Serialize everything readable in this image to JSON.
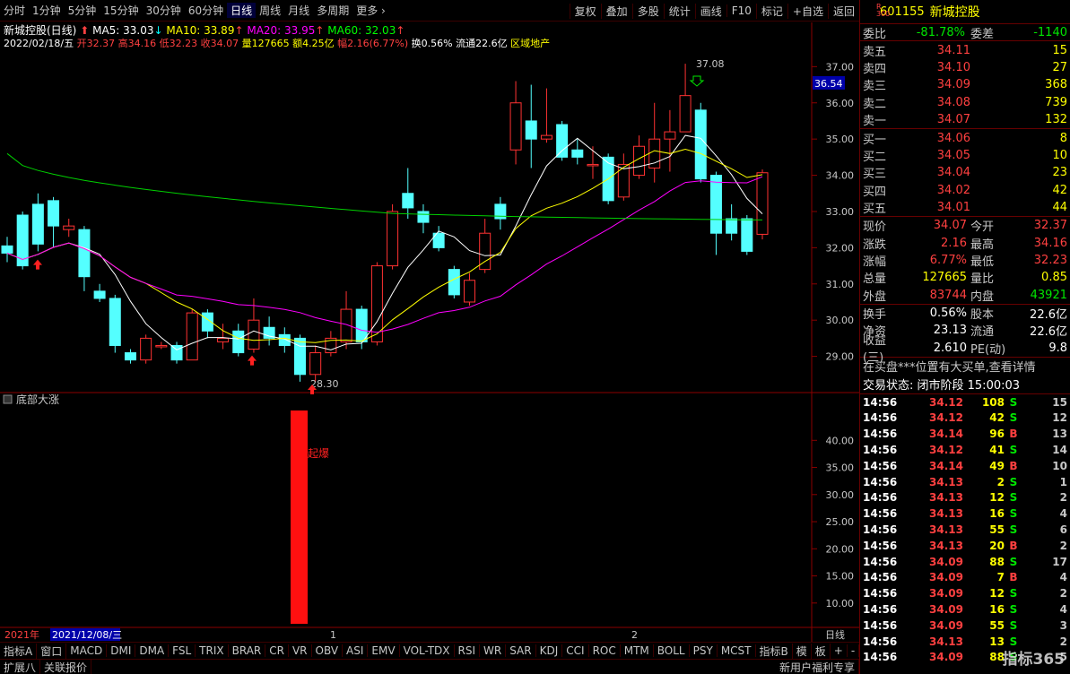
{
  "toolbar": {
    "periods": [
      "分时",
      "1分钟",
      "5分钟",
      "15分钟",
      "30分钟",
      "60分钟",
      "日线",
      "周线",
      "月线",
      "多周期",
      "更多"
    ],
    "active": "日线",
    "right": [
      "复权",
      "叠加",
      "多股",
      "统计",
      "画线",
      "F10",
      "标记",
      "+自选",
      "返回"
    ]
  },
  "info": {
    "title": "新城控股(日线)",
    "ma5": "MA5: 33.03",
    "ma10": "MA10: 33.89",
    "ma20": "MA20: 33.95",
    "ma60": "MA60: 32.03",
    "date": "2022/02/18/五",
    "open": "开32.37",
    "high": "高34.16",
    "low": "低32.23",
    "close": "收34.07",
    "vol": "量127665",
    "amt": "额4.25亿",
    "chg": "幅2.16(6.77%)",
    "turn": "换0.56%",
    "float": "流通22.6亿",
    "sector": "区域地产"
  },
  "chart_data": {
    "type": "candlestick",
    "price_axis": [
      "37.00",
      "36.00",
      "35.00",
      "34.00",
      "33.00",
      "32.00",
      "31.00",
      "30.00",
      "29.00"
    ],
    "current_price_tag": "36.54",
    "max_label": "37.08",
    "min_label": "28.30",
    "candles": [
      [
        32.05,
        31.85,
        32.3,
        31.6
      ],
      [
        32.9,
        31.5,
        33.0,
        31.4
      ],
      [
        33.2,
        32.1,
        33.5,
        31.9
      ],
      [
        33.3,
        32.6,
        33.4,
        32.0
      ],
      [
        32.5,
        32.6,
        32.8,
        32.3
      ],
      [
        32.5,
        31.2,
        32.6,
        30.8
      ],
      [
        30.8,
        30.6,
        31.0,
        30.5
      ],
      [
        30.6,
        29.3,
        30.7,
        29.1
      ],
      [
        29.1,
        28.9,
        29.2,
        28.8
      ],
      [
        28.9,
        29.5,
        29.6,
        28.8
      ],
      [
        29.3,
        29.3,
        29.4,
        29.2
      ],
      [
        29.3,
        28.9,
        29.4,
        28.8
      ],
      [
        28.9,
        30.2,
        30.3,
        28.9
      ],
      [
        30.2,
        29.7,
        30.3,
        29.5
      ],
      [
        29.4,
        29.5,
        29.9,
        29.2
      ],
      [
        29.7,
        29.1,
        29.9,
        29.0
      ],
      [
        29.2,
        30.0,
        30.6,
        29.1
      ],
      [
        29.8,
        29.5,
        30.1,
        29.3
      ],
      [
        29.6,
        29.3,
        29.8,
        29.1
      ],
      [
        29.5,
        28.5,
        29.6,
        28.3
      ],
      [
        28.5,
        29.1,
        29.3,
        28.3
      ],
      [
        29.1,
        29.5,
        29.7,
        29.0
      ],
      [
        29.4,
        30.3,
        30.8,
        29.2
      ],
      [
        30.3,
        29.4,
        30.4,
        29.2
      ],
      [
        29.4,
        31.5,
        31.6,
        29.3
      ],
      [
        31.5,
        33.0,
        33.2,
        31.4
      ],
      [
        33.5,
        33.1,
        34.2,
        32.8
      ],
      [
        33.0,
        32.7,
        33.2,
        32.4
      ],
      [
        32.4,
        32.0,
        32.6,
        31.9
      ],
      [
        31.4,
        30.7,
        31.5,
        30.6
      ],
      [
        30.5,
        31.1,
        31.3,
        30.4
      ],
      [
        31.4,
        32.4,
        32.8,
        31.3
      ],
      [
        33.2,
        32.8,
        33.4,
        32.5
      ],
      [
        34.7,
        36.0,
        36.6,
        34.3
      ],
      [
        35.5,
        35.0,
        36.5,
        34.2
      ],
      [
        35.0,
        35.1,
        36.4,
        34.9
      ],
      [
        35.4,
        34.5,
        35.5,
        34.4
      ],
      [
        34.7,
        34.5,
        35.0,
        34.3
      ],
      [
        34.3,
        34.3,
        34.8,
        33.9
      ],
      [
        34.5,
        33.3,
        34.6,
        33.2
      ],
      [
        33.4,
        34.3,
        34.6,
        33.3
      ],
      [
        34.0,
        34.8,
        35.1,
        33.9
      ],
      [
        34.2,
        35.0,
        36.0,
        33.8
      ],
      [
        35.0,
        35.2,
        35.8,
        34.1
      ],
      [
        35.2,
        36.2,
        37.08,
        35.2
      ],
      [
        35.8,
        33.9,
        36.0,
        33.8
      ],
      [
        34.0,
        32.4,
        34.1,
        31.8
      ],
      [
        32.8,
        32.4,
        33.2,
        32.2
      ],
      [
        32.8,
        31.9,
        32.9,
        31.8
      ],
      [
        32.37,
        34.07,
        34.16,
        32.23
      ]
    ],
    "ma_lines": [
      "MA5",
      "MA10",
      "MA20",
      "MA60"
    ],
    "time_labels": [
      "2021年",
      "2021/12/08/三",
      "1",
      "2",
      "日线"
    ]
  },
  "indicator": {
    "name": "底部大涨",
    "bar_label": "起爆",
    "axis": [
      "40.00",
      "35.00",
      "30.00",
      "25.00",
      "20.00",
      "15.00",
      "10.00"
    ]
  },
  "bottom_tabs": [
    "指标A",
    "窗口",
    "MACD",
    "DMI",
    "DMA",
    "FSL",
    "TRIX",
    "BRAR",
    "CR",
    "VR",
    "OBV",
    "ASI",
    "EMV",
    "VOL-TDX",
    "RSI",
    "WR",
    "SAR",
    "KDJ",
    "CCI",
    "ROC",
    "MTM",
    "BOLL",
    "PSY",
    "MCST",
    "指标B",
    "模",
    "板",
    "+",
    "-"
  ],
  "bottom2": [
    "扩展八",
    "关联报价",
    "新用户福利专享"
  ],
  "panel": {
    "code": "601155",
    "name": "新城控股",
    "r300": "R 300",
    "weibi_label": "委比",
    "weibi": "-81.78%",
    "weicha_label": "委差",
    "weicha": "-1140",
    "asks": [
      [
        "卖五",
        "34.11",
        "15"
      ],
      [
        "卖四",
        "34.10",
        "27"
      ],
      [
        "卖三",
        "34.09",
        "368"
      ],
      [
        "卖二",
        "34.08",
        "739"
      ],
      [
        "卖一",
        "34.07",
        "132"
      ]
    ],
    "bids": [
      [
        "买一",
        "34.06",
        "8"
      ],
      [
        "买二",
        "34.05",
        "10"
      ],
      [
        "买三",
        "34.04",
        "23"
      ],
      [
        "买四",
        "34.02",
        "42"
      ],
      [
        "买五",
        "34.01",
        "44"
      ]
    ],
    "stats": [
      [
        "现价",
        "34.07",
        "今开",
        "32.37"
      ],
      [
        "涨跌",
        "2.16",
        "最高",
        "34.16"
      ],
      [
        "涨幅",
        "6.77%",
        "最低",
        "32.23"
      ],
      [
        "总量",
        "127665",
        "量比",
        "0.85"
      ],
      [
        "外盘",
        "83744",
        "内盘",
        "43921"
      ]
    ],
    "stats2": [
      [
        "换手",
        "0.56%",
        "股本",
        "22.6亿"
      ],
      [
        "净资",
        "23.13",
        "流通",
        "22.6亿"
      ],
      [
        "收益(三)",
        "2.610",
        "PE(动)",
        "9.8"
      ]
    ],
    "notice": "在买盘***位置有大买单,查看详情",
    "status": "交易状态: 闭市阶段 15:00:03",
    "ticks": [
      [
        "14:56",
        "34.12",
        "108",
        "S",
        "15"
      ],
      [
        "14:56",
        "34.12",
        "42",
        "S",
        "12"
      ],
      [
        "14:56",
        "34.14",
        "96",
        "B",
        "13"
      ],
      [
        "14:56",
        "34.12",
        "41",
        "S",
        "14"
      ],
      [
        "14:56",
        "34.14",
        "49",
        "B",
        "10"
      ],
      [
        "14:56",
        "34.13",
        "2",
        "S",
        "1"
      ],
      [
        "14:56",
        "34.13",
        "12",
        "S",
        "2"
      ],
      [
        "14:56",
        "34.13",
        "16",
        "S",
        "4"
      ],
      [
        "14:56",
        "34.13",
        "55",
        "S",
        "6"
      ],
      [
        "14:56",
        "34.13",
        "20",
        "B",
        "2"
      ],
      [
        "14:56",
        "34.09",
        "88",
        "S",
        "17"
      ],
      [
        "14:56",
        "34.09",
        "7",
        "B",
        "4"
      ],
      [
        "14:56",
        "34.09",
        "12",
        "S",
        "2"
      ],
      [
        "14:56",
        "34.09",
        "16",
        "S",
        "4"
      ],
      [
        "14:56",
        "34.09",
        "55",
        "S",
        "3"
      ],
      [
        "14:56",
        "34.13",
        "13",
        "S",
        "2"
      ],
      [
        "14:56",
        "34.09",
        "88",
        "S",
        "5"
      ]
    ]
  },
  "watermark": "指标365"
}
